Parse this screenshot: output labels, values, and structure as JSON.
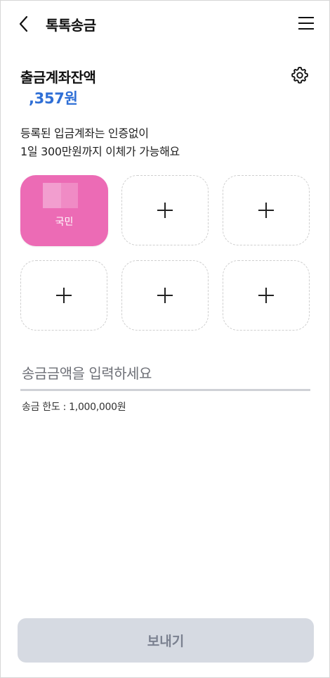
{
  "header": {
    "title": "톡톡송금"
  },
  "balance": {
    "label": "출금계좌잔액",
    "amount": ",357원"
  },
  "description": {
    "line1": "등록된 입금계좌는 인증없이",
    "line2": "1일 300만원까지 이체가 가능해요"
  },
  "accounts": {
    "registered": {
      "bank_name": "국민",
      "color": "#ec6bb5"
    },
    "empty_slot_count": 5
  },
  "amount_input": {
    "placeholder": "송금금액을 입력하세요",
    "value": ""
  },
  "limit_text": "송금 한도 : 1,000,000원",
  "send_button": {
    "label": "보내기"
  },
  "colors": {
    "accent_blue": "#2f6fd6",
    "bank_pink": "#ec6bb5",
    "button_disabled": "#d6dae2"
  }
}
